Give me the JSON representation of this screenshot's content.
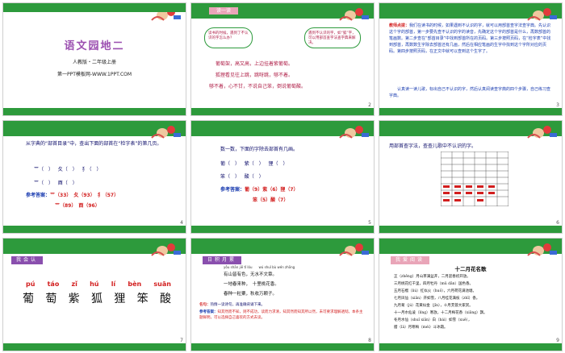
{
  "s1": {
    "title": "语文园地二",
    "subtitle": "人教版・二年级上册",
    "footer": "第一PPT模板网-WWW.1PPT.COM",
    "number": ""
  },
  "s2": {
    "tag": "读一读",
    "bubble_left": "读书的时候，遇到了不认识的字怎么办？",
    "bubble_right": "遇到不认识的字，如“狐”字，可以用部首查字法查字典来解决。",
    "lines": [
      "葡萄架，高又高，上边挂着紫葡萄。",
      "狐狸看见往上跳，跳呀跳，够不着。",
      "够不着，心不甘，不说自己笨，倒说葡萄酸。"
    ],
    "number": "2"
  },
  "s3": {
    "label": "教师点拨：",
    "body": "我们在读书的时候，如果遇到不认识的字，就可以用部首查字法查字典。先认识这个字的部首，第一步要先查不认识的字的读音，先确定这个字的部首是什么，再数部首的笔画数。第二步查在“部首目录”中找到部首所在的页码。第三步按照页码，在“检字表”中找到部首，再数数生字除去部首还有几画，然后在相应笔画的生字中找到这个字所对应的页码。第四步按照页码，在正文中就可以查到这个生字了。",
    "body2": "认真读一读儿歌，标出自己不认识的字，然后认真阅读查字典的四个步骤，自己练习查字典。",
    "number": "3"
  },
  "s4": {
    "prompt": "从字典的“部首目录”中，查出下面的部首在“检字表”的第几页。",
    "row1": [
      "艹（　）",
      "夂（　）",
      "犭（　）"
    ],
    "row2": [
      "艹（　）",
      "酉（　）"
    ],
    "answer_label": "参考答案：",
    "answer1": "艹（33）　夂（93）　犭（57）",
    "answer2": "艹（89）　酉（96）",
    "number": "4"
  },
  "s5": {
    "prompt": "数一数，下面的字除去部首有几画。",
    "row1": [
      "葡（　）",
      "紫（　）",
      "狸（　）"
    ],
    "row2": [
      "笨（　）",
      "酸（　）"
    ],
    "answer_label": "参考答案：",
    "answer1": "葡（9）紫（6）狸（7）",
    "answer2": "笨（5）酸（7）",
    "number": "5"
  },
  "s6": {
    "prompt": "用部首查字法，查查儿歌中不认识的字。",
    "number": "6"
  },
  "s7": {
    "tag": "我会认",
    "pinyin": [
      "pú",
      "táo",
      "zǐ",
      "hú",
      "lí",
      "bèn",
      "suān"
    ],
    "chars": [
      "葡",
      "萄",
      "紫",
      "狐",
      "狸",
      "笨",
      "酸"
    ],
    "number": "7"
  },
  "s8": {
    "tag": "日积月累",
    "pinyin1": "yǒu shān jiē tǐ lóu　　wú shuǐ bù wén zhōng",
    "lines": [
      "有山皆有色，无水不文章。",
      "一地春来种，　十里桃花香。",
      "春种一粒粟，秋收万颗子。"
    ],
    "note_label": "名句：",
    "note": "热情一读诗句，再准确背诵下来。",
    "ref_label": "参考答案：",
    "ref": "知其然而不知，则不成功，读而力求清，知其然而知其所以然，未可要求理解透彻。本条主题鲜明，可以选择自己喜欢的方式去读。",
    "number": "8"
  },
  "s9": {
    "tag": "我爱阅读",
    "title": "十二月花名歌",
    "lines": [
      "正（zhēng）月山茶满盆开，二月迎春初开放。",
      "三月桃花红千里，四月牡丹（mǔ dān）国色香。",
      "五月石榴（liú）红似火（huǒ），六月荷花满池塘。",
      "七月凤仙（xiān）开如雪，八月桂花满枝（zhī）香。",
      "九月菊（jú）花黄似金（jīn），十月芙蓉大家赏。",
      "十一月水仙凌（líng）寒放，十二月梅花香（xiāng）飘。",
      "冬月水仙（shuǐ xiān）白（bái）如雪（xuě），",
      "腊（là）月寒梅（méi）斗冰霜。"
    ],
    "number": "9"
  },
  "colors": {
    "green": "#2d9a3c",
    "red": "#d21e1e",
    "blue": "#1a3cb0",
    "pink": "#e9a5b8"
  }
}
